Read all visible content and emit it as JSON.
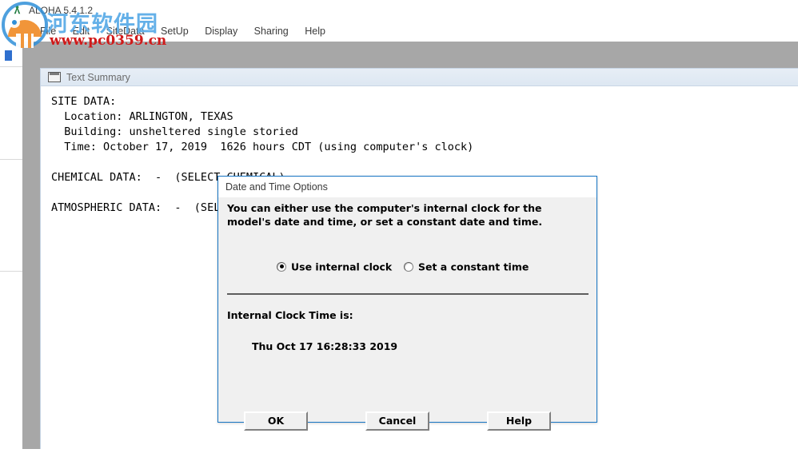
{
  "app": {
    "title": "ALOHA 5.4.1.2",
    "title_icon": "aloha-app-icon",
    "menu": [
      {
        "label": "File",
        "name": "menu-file"
      },
      {
        "label": "Edit",
        "name": "menu-edit"
      },
      {
        "label": "SiteData",
        "name": "menu-sitedata"
      },
      {
        "label": "SetUp",
        "name": "menu-setup"
      },
      {
        "label": "Display",
        "name": "menu-display"
      },
      {
        "label": "Sharing",
        "name": "menu-sharing"
      },
      {
        "label": "Help",
        "name": "menu-help"
      }
    ]
  },
  "text_summary": {
    "title": "Text Summary",
    "title_icon": "text-document-icon",
    "lines": [
      "SITE DATA:",
      "  Location: ARLINGTON, TEXAS",
      "  Building: unsheltered single storied",
      "  Time: October 17, 2019  1626 hours CDT (using computer's clock)",
      "",
      "CHEMICAL DATA:  -  (SELECT CHEMICAL)",
      "",
      "ATMOSPHERIC DATA:  -  (SEL"
    ]
  },
  "dialog": {
    "title": "Date and Time Options",
    "intro": "You can either use the computer's internal clock for the model's date and time, or set a constant date and time.",
    "options": [
      {
        "label": "Use internal clock",
        "selected": true,
        "name": "radio-use-internal-clock"
      },
      {
        "label": "Set a constant time",
        "selected": false,
        "name": "radio-set-constant-time"
      }
    ],
    "clock_label": "Internal Clock Time is:",
    "clock_value": "Thu Oct 17 16:28:33 2019",
    "buttons": [
      {
        "label": "OK",
        "name": "ok-button",
        "default": true
      },
      {
        "label": "Cancel",
        "name": "cancel-button",
        "default": false
      },
      {
        "label": "Help",
        "name": "help-button",
        "default": false
      }
    ],
    "accent_color": "#1775c4"
  },
  "watermark": {
    "site_name": "河东软件园",
    "url": "www.pc0359.cn",
    "name_color": "#64b0e8",
    "url_color": "#d01a1a"
  }
}
